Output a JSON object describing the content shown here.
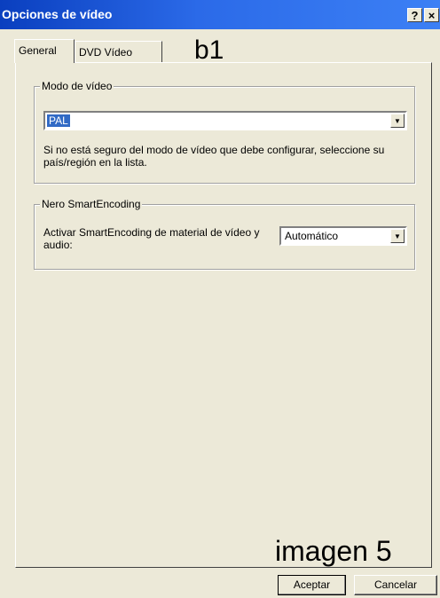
{
  "window": {
    "title": "Opciones de vídeo",
    "help_glyph": "?",
    "close_glyph": "×"
  },
  "tabs": [
    {
      "label": "General",
      "selected": true
    },
    {
      "label": "DVD Vídeo",
      "selected": false
    }
  ],
  "annotations": {
    "top_label": "b1",
    "bottom_label": "imagen 5"
  },
  "video_mode": {
    "legend": "Modo de vídeo",
    "selected_value": "PAL",
    "help_text": "Si no está seguro del modo de vídeo que debe configurar, seleccione su país/región en la lista."
  },
  "smart_encoding": {
    "legend": "Nero SmartEncoding",
    "label": "Activar SmartEncoding de material de vídeo y audio:",
    "selected_value": "Automático"
  },
  "buttons": {
    "ok_label": "Aceptar",
    "cancel_label": "Cancelar"
  },
  "icons": {
    "combo_arrow": "chevron-down-icon"
  },
  "colors": {
    "titlebar": "#2b6ae8",
    "selection": "#316ac5",
    "dialog_bg": "#ece9d8"
  }
}
